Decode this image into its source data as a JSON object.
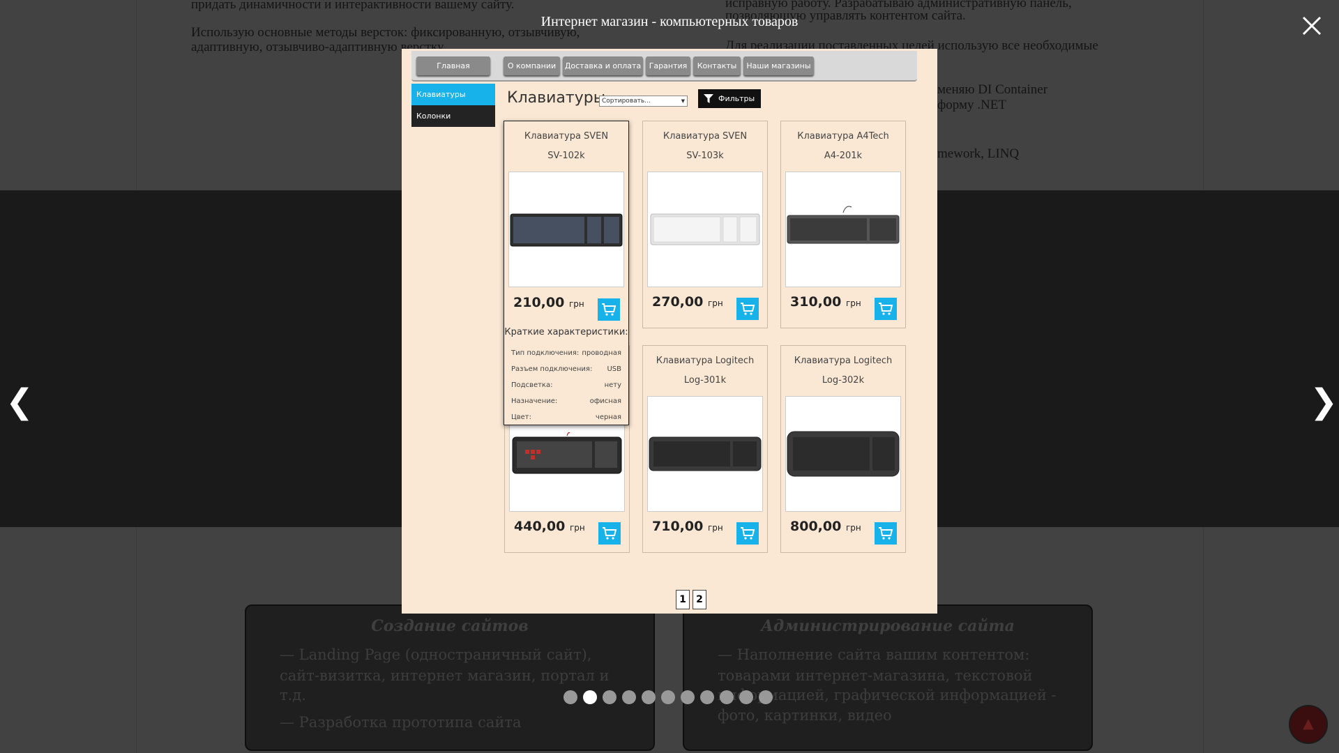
{
  "lightbox": {
    "caption": "Интернет магазин - компьютерных товаров",
    "prev_arrow": "❮",
    "next_arrow": "❯",
    "dots_count": 11,
    "active_dot": 1,
    "scroll_top": "▲"
  },
  "background": {
    "left_line1": "придать динамичности и интерактивности вашему сайту.",
    "left_line2": "Использую основные методы версток: фиксированную, отзывчивую,",
    "left_line3": "адаптивную, отзывчиво-адаптивную верстку.",
    "right_line1": "исправную работу. Разрабатываю административную панель,",
    "right_line2": "позволяющую управлять контентом сайта.",
    "right_line3": "Для реализации поставленных целей использую все необходимые",
    "right_line4": "меняю DI Container",
    "right_line5": "форму .NET",
    "right_line6": "mework, LINQ",
    "card_left": {
      "title": "Создание сайтов",
      "line1": "— Landing Page (одностраничный сайт),",
      "line2": "сайт-визитка, интернет магазин, портал и",
      "line3": "т.д.",
      "line4": "— Разработка прототипа сайта"
    },
    "card_right": {
      "title": "Администрирование сайта",
      "line1": "— Наполнение сайта вашим контентом:",
      "line2": "товарами интернет-магазина, текстовой",
      "line3": "информацией, графической информацией -",
      "line4": "фото, картинки, видео"
    }
  },
  "shop": {
    "nav": [
      "Главная",
      "О компании",
      "Доставка и оплата",
      "Гарантия",
      "Контакты",
      "Наши магазины"
    ],
    "sidebar": [
      "Клавиатуры",
      "Колонки"
    ],
    "page_title": "Клавиатуры",
    "sort_placeholder": "Сортировать...",
    "filter_label": "Фильтры",
    "currency": "грн",
    "products": [
      {
        "line1": "Клавиатура SVEN",
        "line2": "SV-102k",
        "price": "210,00"
      },
      {
        "line1": "Клавиатура SVEN",
        "line2": "SV-103k",
        "price": "270,00"
      },
      {
        "line1": "Клавиатура A4Tech",
        "line2": "A4-201k",
        "price": "310,00"
      },
      {
        "line1": "",
        "line2": "",
        "price": "440,00"
      },
      {
        "line1": "Клавиатура Logitech",
        "line2": "Log-301k",
        "price": "710,00"
      },
      {
        "line1": "Клавиатура Logitech",
        "line2": "Log-302k",
        "price": "800,00"
      }
    ],
    "specs_title": "Краткие характеристики:",
    "specs": [
      {
        "k": "Тип подключения:",
        "v": "проводная"
      },
      {
        "k": "Разъем подключения:",
        "v": "USB"
      },
      {
        "k": "Подсветка:",
        "v": "нету"
      },
      {
        "k": "Назначение:",
        "v": "офисная"
      },
      {
        "k": "Цвет:",
        "v": "черная"
      }
    ],
    "pages": [
      "1",
      "2"
    ],
    "colors": {
      "accent": "#17b2ea",
      "bg": "#fae8d4",
      "nav_btn": "#8a8a8a"
    }
  }
}
